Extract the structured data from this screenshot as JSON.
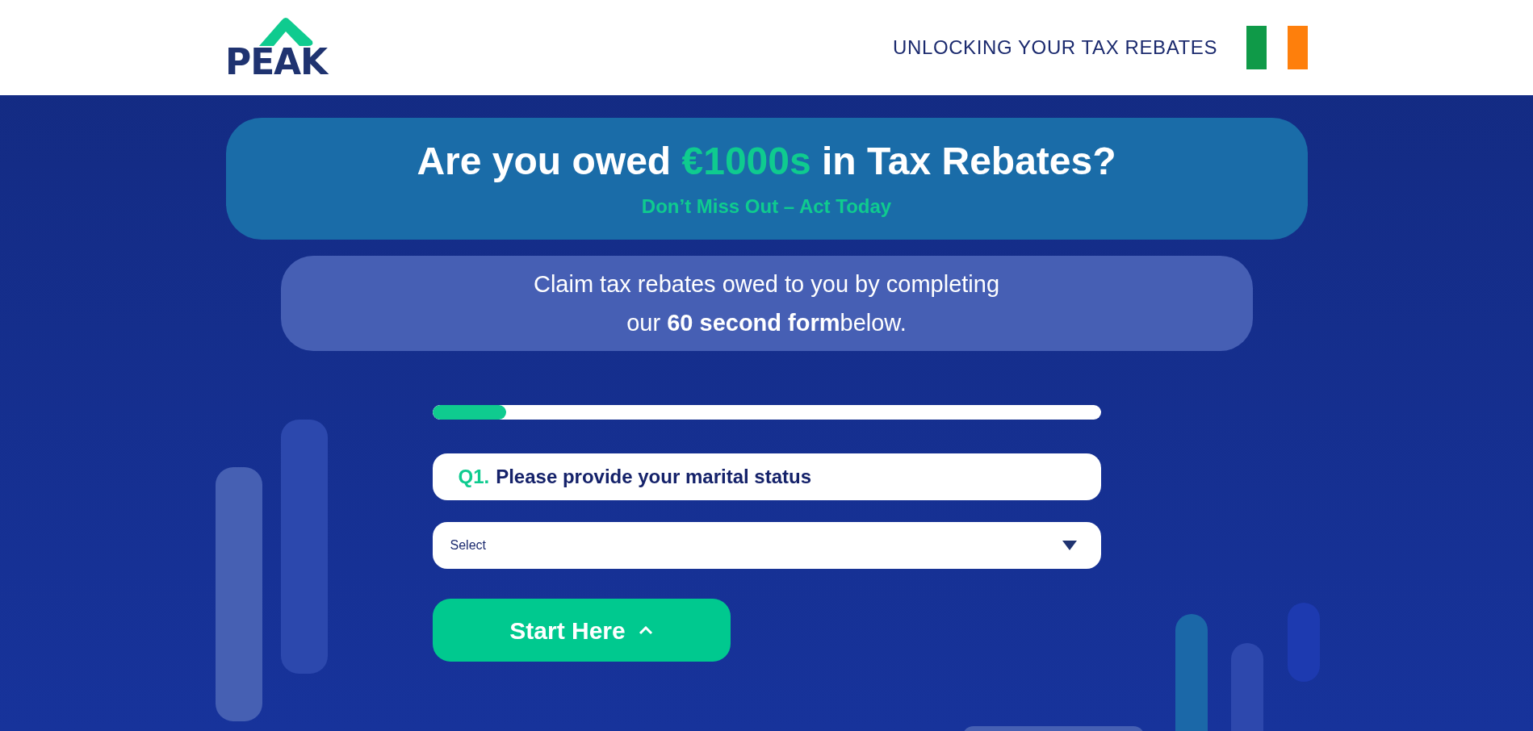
{
  "header": {
    "logo_text": "PEAK",
    "tagline": "UNLOCKING YOUR TAX REBATES"
  },
  "hero": {
    "headline": [
      {
        "text": "Are you owed ",
        "highlight": false
      },
      {
        "text": "€1000s",
        "highlight": true
      },
      {
        "text": " in Tax Rebates?",
        "highlight": false
      }
    ],
    "subheadline": "Don’t Miss Out – Act Today"
  },
  "intro": {
    "lines": [
      "Claim tax rebates owed to you by completing",
      "our **60 second form**below."
    ]
  },
  "form": {
    "progress": {
      "level": 0.11
    },
    "question": {
      "number": "Q1.",
      "text": "Please provide your marital status"
    },
    "select": {
      "value": "Select"
    },
    "button": {
      "label": "Start Here"
    }
  }
}
